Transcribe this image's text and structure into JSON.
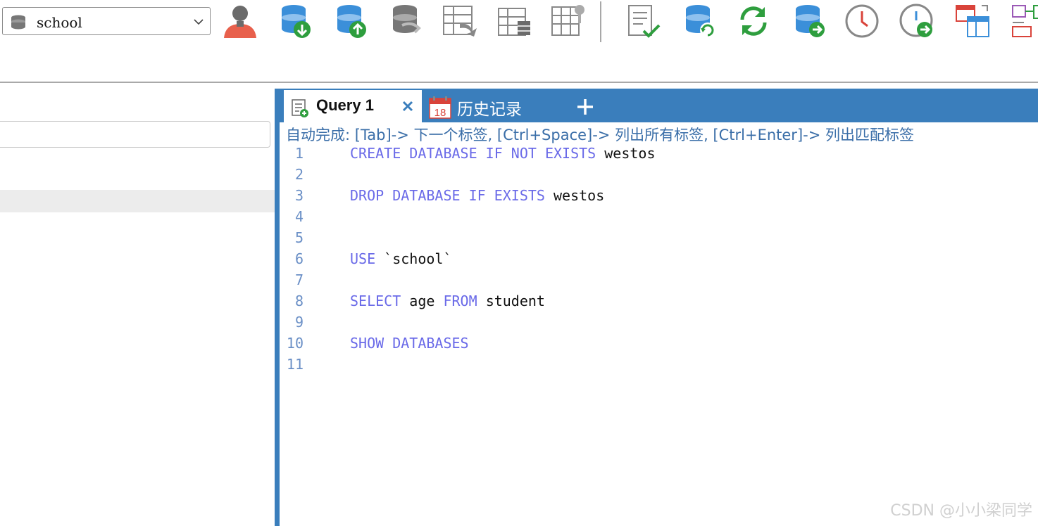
{
  "toolbar": {
    "database_select": {
      "value": "school"
    },
    "buttons": [
      {
        "name": "user-manager-icon"
      },
      {
        "name": "backup-database-icon"
      },
      {
        "name": "restore-database-icon"
      },
      {
        "name": "database-sync-icon"
      },
      {
        "name": "import-table-icon"
      },
      {
        "name": "schema-table-icon"
      },
      {
        "name": "data-search-icon"
      },
      {
        "name": "execute-query-icon"
      },
      {
        "name": "database-refresh-icon"
      },
      {
        "name": "refresh-icon"
      },
      {
        "name": "database-forward-icon"
      },
      {
        "name": "schedule-clock-icon"
      },
      {
        "name": "schedule-run-icon"
      },
      {
        "name": "compare-layout-icon"
      },
      {
        "name": "structure-compare-icon"
      }
    ]
  },
  "tabs": [
    {
      "label": "Query 1",
      "active": true
    },
    {
      "label": "历史记录",
      "active": false
    }
  ],
  "editor": {
    "hint": "自动完成: [Tab]-> 下一个标签, [Ctrl+Space]-> 列出所有标签, [Ctrl+Enter]-> 列出匹配标签",
    "line_numbers": [
      "1",
      "2",
      "3",
      "4",
      "5",
      "6",
      "7",
      "8",
      "9",
      "10",
      "11"
    ],
    "lines": {
      "l1": {
        "kw": "CREATE DATABASE IF NOT EXISTS",
        "id": "westos"
      },
      "l3": {
        "kw": "DROP DATABASE IF EXISTS",
        "id": "westos"
      },
      "l6": {
        "kw": "USE",
        "id": "`school`"
      },
      "l8": {
        "kw1": "SELECT",
        "id1": "age",
        "kw2": "FROM",
        "id2": "student"
      },
      "l10": {
        "kw": "SHOW DATABASES"
      }
    }
  },
  "watermark": "CSDN @小小梁同学",
  "colors": {
    "accent_blue": "#3a7ebc",
    "keyword": "#6a6ae8",
    "line_number": "#6a8fc6",
    "hint_text": "#3a6ea8"
  }
}
